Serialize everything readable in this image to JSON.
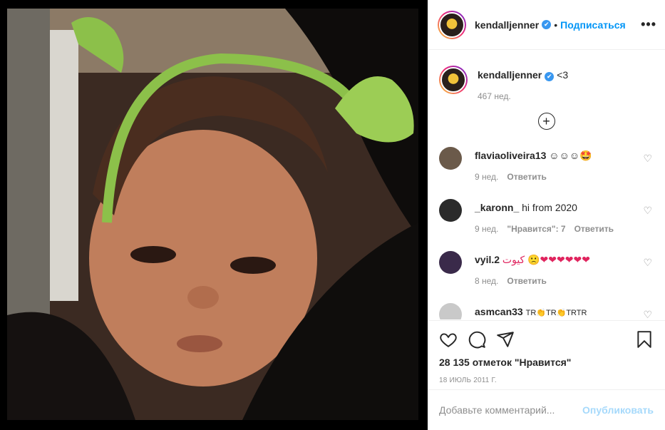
{
  "post": {
    "author": "kendalljenner",
    "follow_label": "Подписаться",
    "more_label": "•••",
    "caption": "<3",
    "caption_age": "467 нед.",
    "load_more_label": "+"
  },
  "comments": [
    {
      "user": "flaviaoliveira13",
      "text": "☺☺☺🤩",
      "age": "9 нед.",
      "likes": "",
      "reply": "Ответить",
      "avatar_color": "#6b5a4a"
    },
    {
      "user": "_karonn_",
      "text": "hi from 2020",
      "age": "9 нед.",
      "likes": "\"Нравится\": 7",
      "reply": "Ответить",
      "avatar_color": "#2b2b2b"
    },
    {
      "user": "vyil.2",
      "text": "كيوت 🙁❤❤❤❤❤❤",
      "age": "8 нед.",
      "likes": "",
      "reply": "Ответить",
      "avatar_color": "#3a2a4a"
    },
    {
      "user": "asmcan33",
      "text": "TR👏TR👏TRTR",
      "age": "",
      "likes": "",
      "reply": "",
      "avatar_color": "#c9c9c9"
    }
  ],
  "stats": {
    "likes_text": "28 135 отметок \"Нравится\"",
    "date_text": "18 июль 2011 г."
  },
  "input": {
    "placeholder": "Добавьте комментарий...",
    "publish_label": "Опубликовать"
  },
  "icons": {
    "verified": "verified-badge",
    "like": "heart-icon",
    "comment": "comment-icon",
    "share": "send-icon",
    "save": "bookmark-icon",
    "more": "more-options-icon",
    "add": "plus-circle-icon"
  },
  "colors": {
    "accent": "#0095f6",
    "verified": "#3897f0",
    "text": "#262626",
    "muted": "#8e8e8e"
  }
}
